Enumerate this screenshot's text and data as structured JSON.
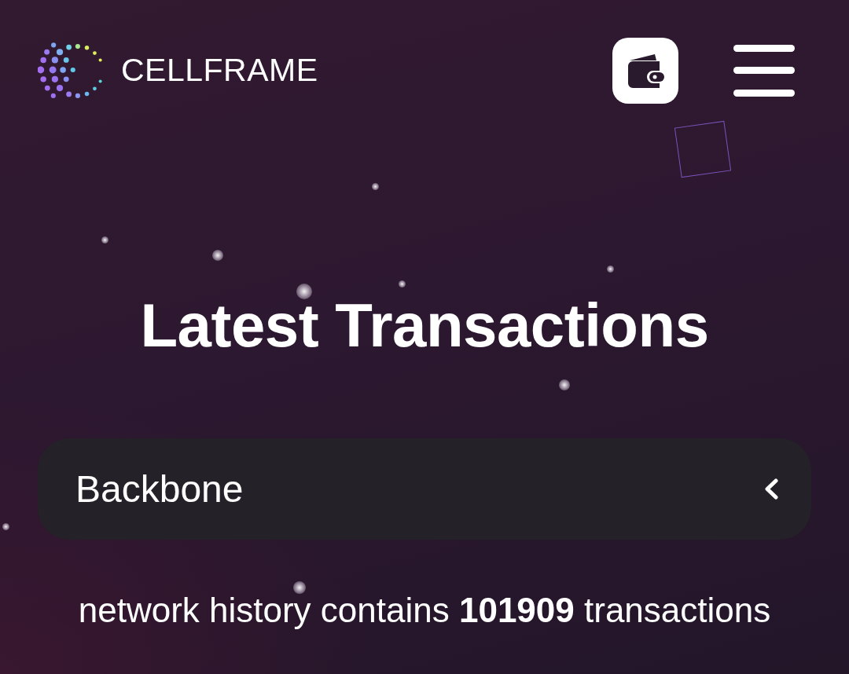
{
  "header": {
    "logo_text": "CELLFRAME"
  },
  "title": "Latest Transactions",
  "network_select": {
    "value": "Backbone"
  },
  "summary": "network history contains **101909** transactions"
}
